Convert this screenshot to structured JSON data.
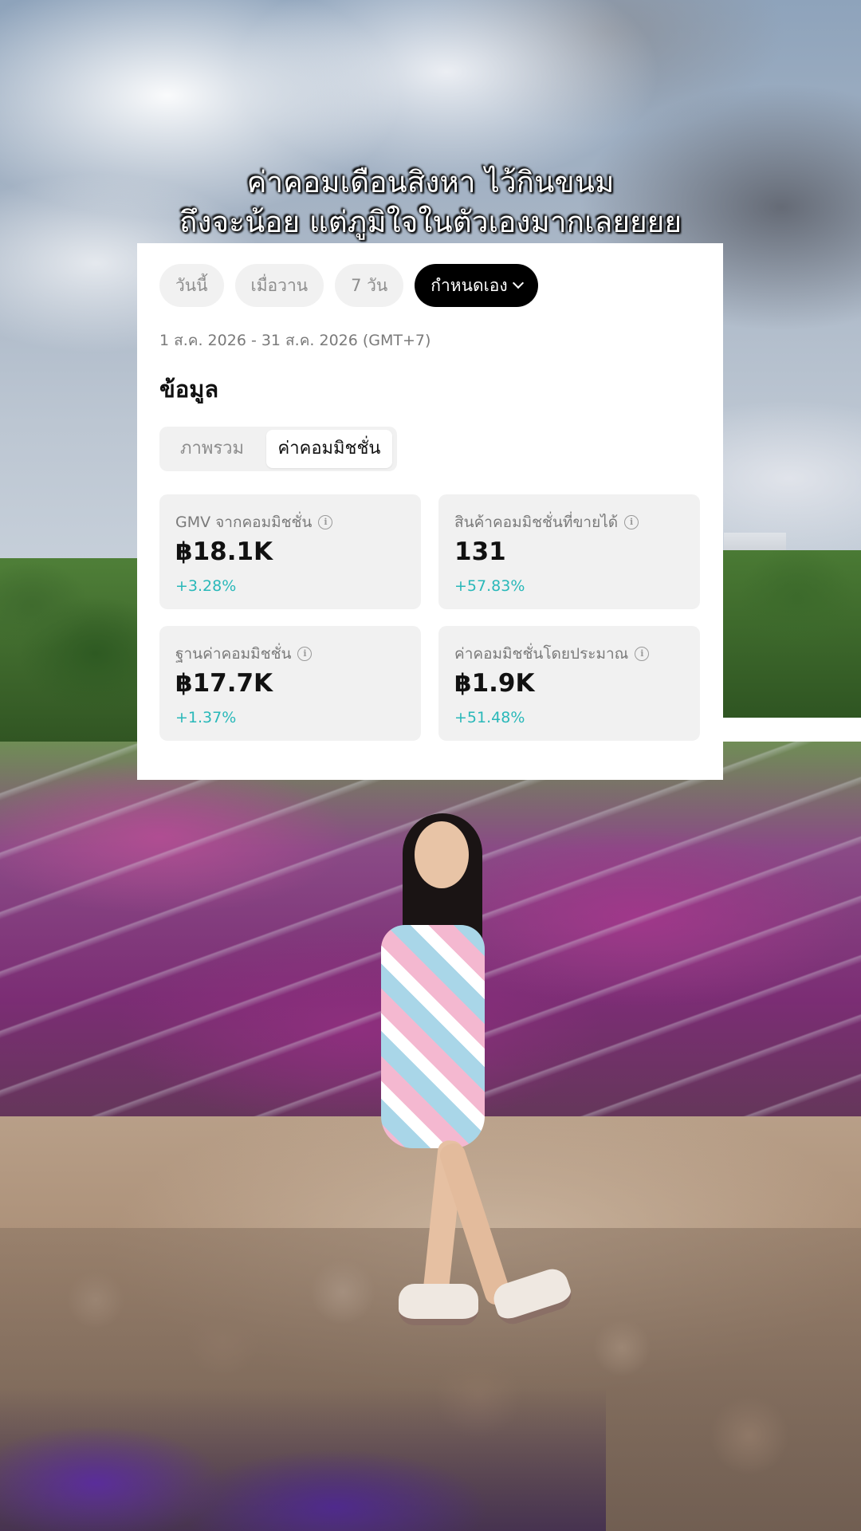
{
  "caption": {
    "line1": "ค่าคอมเดือนสิงหา ไว้กินขนม",
    "line2": "ถึงจะน้อย แต่ภูมิใจในตัวเองมากเลยยยย"
  },
  "date_tabs": [
    {
      "label": "วันนี้"
    },
    {
      "label": "เมื่อวาน"
    },
    {
      "label": "7 วัน"
    },
    {
      "label": "กำหนดเอง"
    }
  ],
  "date_range": "1 ส.ค. 2026 - 31 ส.ค. 2026 (GMT+7)",
  "section_title": "ข้อมูล",
  "segments": [
    {
      "label": "ภาพรวม"
    },
    {
      "label": "ค่าคอมมิชชั่น"
    }
  ],
  "metrics": [
    {
      "label": "GMV จากคอมมิชชั่น",
      "value": "฿18.1K",
      "change": "+3.28%"
    },
    {
      "label": "สินค้าคอมมิชชั่นที่ขายได้",
      "value": "131",
      "change": "+57.83%"
    },
    {
      "label": "ฐานค่าคอมมิชชั่น",
      "value": "฿17.7K",
      "change": "+1.37%"
    },
    {
      "label": "ค่าคอมมิชชั่นโดยประมาณ",
      "value": "฿1.9K",
      "change": "+51.48%"
    }
  ],
  "colors": {
    "positive_change": "#29b8b9",
    "active_tab": "#000000",
    "card_bg": "#f1f1f1"
  }
}
